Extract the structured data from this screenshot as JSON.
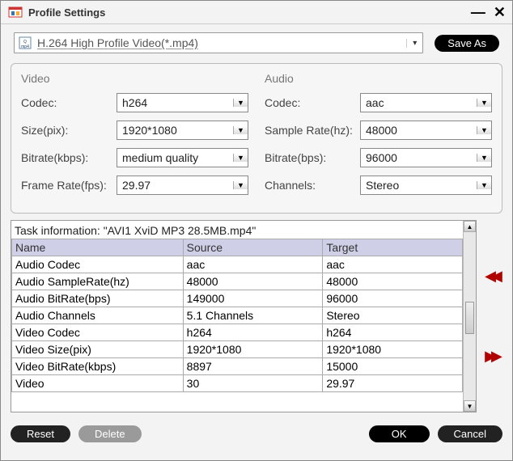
{
  "title": "Profile Settings",
  "profile_dropdown": "H.264 High Profile Video(*.mp4)",
  "save_as": "Save As",
  "video": {
    "title": "Video",
    "codec_label": "Codec:",
    "codec_value": "h264",
    "size_label": "Size(pix):",
    "size_value": "1920*1080",
    "bitrate_label": "Bitrate(kbps):",
    "bitrate_value": "medium quality",
    "framerate_label": "Frame Rate(fps):",
    "framerate_value": "29.97"
  },
  "audio": {
    "title": "Audio",
    "codec_label": "Codec:",
    "codec_value": "aac",
    "samplerate_label": "Sample Rate(hz):",
    "samplerate_value": "48000",
    "bitrate_label": "Bitrate(bps):",
    "bitrate_value": "96000",
    "channels_label": "Channels:",
    "channels_value": "Stereo"
  },
  "task_info": "Task information: \"AVI1 XviD MP3 28.5MB.mp4\"",
  "table": {
    "headers": {
      "name": "Name",
      "source": "Source",
      "target": "Target"
    },
    "rows": [
      {
        "name": "Audio Codec",
        "source": "aac",
        "target": "aac"
      },
      {
        "name": "Audio SampleRate(hz)",
        "source": "48000",
        "target": "48000"
      },
      {
        "name": "Audio BitRate(bps)",
        "source": "149000",
        "target": "96000"
      },
      {
        "name": "Audio Channels",
        "source": "5.1 Channels",
        "target": "Stereo"
      },
      {
        "name": "Video Codec",
        "source": "h264",
        "target": "h264"
      },
      {
        "name": "Video Size(pix)",
        "source": "1920*1080",
        "target": "1920*1080"
      },
      {
        "name": "Video BitRate(kbps)",
        "source": "8897",
        "target": "15000"
      },
      {
        "name": "Video",
        "source": "30",
        "target": "29.97"
      }
    ]
  },
  "buttons": {
    "reset": "Reset",
    "delete": "Delete",
    "ok": "OK",
    "cancel": "Cancel"
  }
}
